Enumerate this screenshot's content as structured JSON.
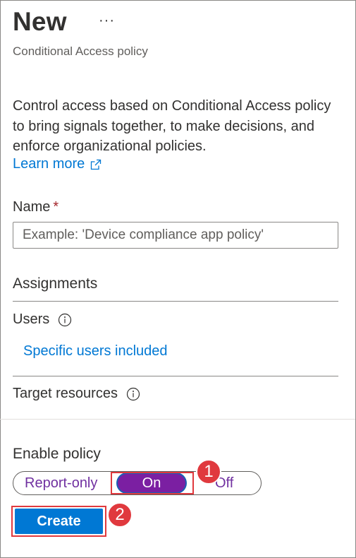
{
  "header": {
    "title": "New",
    "more_label": "···",
    "subtitle": "Conditional Access policy"
  },
  "intro": {
    "description": "Control access based on Conditional Access policy to bring signals together, to make decisions, and enforce organizational policies.",
    "learn_more_label": "Learn more"
  },
  "name_field": {
    "label": "Name",
    "required_marker": "*",
    "value": "",
    "placeholder": "Example: 'Device compliance app policy'"
  },
  "assignments": {
    "heading": "Assignments",
    "users": {
      "label": "Users",
      "value_link": "Specific users included"
    },
    "target_resources": {
      "label": "Target resources"
    }
  },
  "enable_policy": {
    "label": "Enable policy",
    "options": [
      "Report-only",
      "On",
      "Off"
    ],
    "selected": "On"
  },
  "actions": {
    "create_label": "Create"
  },
  "annotations": {
    "step1": "1",
    "step2": "2",
    "color": "#e0393e"
  },
  "colors": {
    "link": "#0078d4",
    "primary_button": "#0078d4",
    "toggle_selected": "#7b1fa2",
    "toggle_text": "#7030a0",
    "required": "#a4262c"
  }
}
